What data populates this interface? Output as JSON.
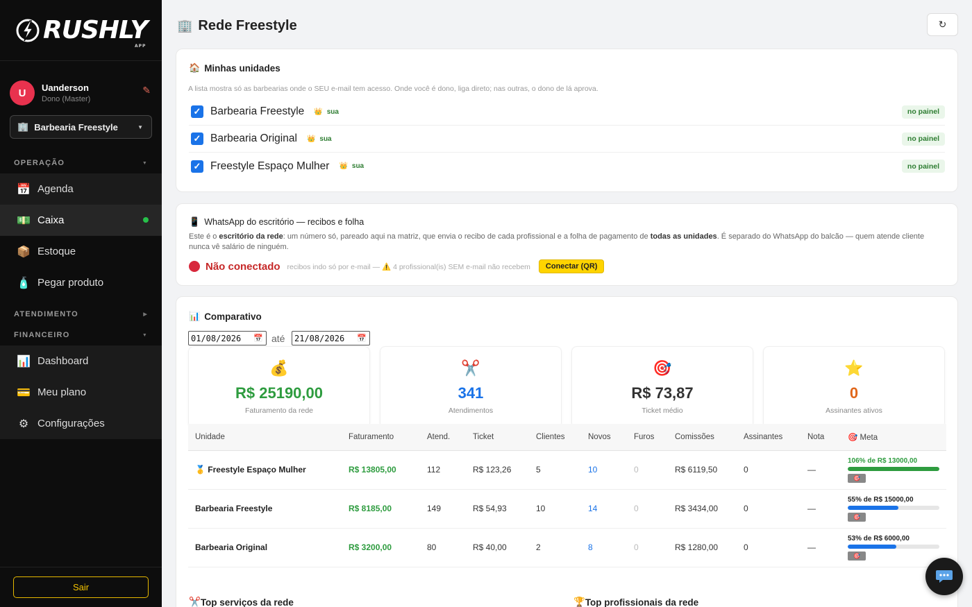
{
  "brand": {
    "name": "RUSHLY",
    "sub": "APP"
  },
  "user": {
    "initial": "U",
    "name": "Uanderson",
    "role": "Dono (Master)"
  },
  "shop_selector": {
    "value": "Barbearia Freestyle"
  },
  "sidebar": {
    "sections": {
      "operacao": "OPERAÇÃO",
      "atendimento": "ATENDIMENTO",
      "financeiro": "FINANCEIRO"
    },
    "items": {
      "agenda": "Agenda",
      "caixa": "Caixa",
      "estoque": "Estoque",
      "pegar": "Pegar produto",
      "dashboard": "Dashboard",
      "plano": "Meu plano",
      "config": "Configurações"
    },
    "logout": "Sair"
  },
  "page": {
    "title": "Rede Freestyle"
  },
  "units_card": {
    "title": "Minhas unidades",
    "hint": "A lista mostra só as barbearias onde o SEU e-mail tem acesso. Onde você é dono, liga direto; nas outras, o dono de lá aprova.",
    "units": [
      {
        "name": "Barbearia Freestyle",
        "tag": "sua",
        "badge": "no painel"
      },
      {
        "name": "Barbearia Original",
        "tag": "sua",
        "badge": "no painel"
      },
      {
        "name": "Freestyle Espaço Mulher",
        "tag": "sua",
        "badge": "no painel"
      }
    ]
  },
  "whatsapp_card": {
    "title": "WhatsApp do escritório — recibos e folha",
    "desc_pre": "Este é o ",
    "desc_b1": "escritório da rede",
    "desc_mid": ": um número só, pareado aqui na matriz, que envia o recibo de cada profissional e a folha de pagamento de ",
    "desc_b2": "todas as unidades",
    "desc_post": ". É separado do WhatsApp do balcão — quem atende cliente nunca vê salário de ninguém.",
    "status": "Não conectado",
    "status_hint": "recibos indo só por e-mail — ⚠️ 4 profissional(is) SEM e-mail não recebem",
    "connect": "Conectar (QR)",
    "status_color": "#c62828"
  },
  "compare_card": {
    "title": "Comparativo",
    "date_from": "01/08/2026",
    "date_sep": "até",
    "date_to": "21/08/2026",
    "kpis": [
      {
        "icon": "💰",
        "value": "R$ 25190,00",
        "label": "Faturamento da rede",
        "color": "#2e9c3f"
      },
      {
        "icon": "✂️",
        "value": "341",
        "label": "Atendimentos",
        "color": "#1a73e8"
      },
      {
        "icon": "🎯",
        "value": "R$ 73,87",
        "label": "Ticket médio",
        "color": "#333333"
      },
      {
        "icon": "⭐",
        "value": "0",
        "label": "Assinantes ativos",
        "color": "#e0661a"
      }
    ],
    "columns": [
      "Unidade",
      "Faturamento",
      "Atend.",
      "Ticket",
      "Clientes",
      "Novos",
      "Furos",
      "Comissões",
      "Assinantes",
      "Nota",
      "Meta"
    ],
    "rows": [
      {
        "medal": "🥇",
        "unit": "Freestyle Espaço Mulher",
        "fat": "R$ 13805,00",
        "atend": "112",
        "ticket": "R$ 123,26",
        "clientes": "5",
        "novos": "10",
        "furos": "0",
        "comissoes": "R$ 6119,50",
        "assinantes": "0",
        "nota": "—",
        "meta_label": "106% de R$ 13000,00",
        "meta_pct": 1.0,
        "meta_color": "#2e9c3f"
      },
      {
        "medal": "",
        "unit": "Barbearia Freestyle",
        "fat": "R$ 8185,00",
        "atend": "149",
        "ticket": "R$ 54,93",
        "clientes": "10",
        "novos": "14",
        "furos": "0",
        "comissoes": "R$ 3434,00",
        "assinantes": "0",
        "nota": "—",
        "meta_label": "55% de R$ 15000,00",
        "meta_pct": 0.55,
        "meta_color": "#1a73e8"
      },
      {
        "medal": "",
        "unit": "Barbearia Original",
        "fat": "R$ 3200,00",
        "atend": "80",
        "ticket": "R$ 40,00",
        "clientes": "2",
        "novos": "8",
        "furos": "0",
        "comissoes": "R$ 1280,00",
        "assinantes": "0",
        "nota": "—",
        "meta_label": "53% de R$ 6000,00",
        "meta_pct": 0.53,
        "meta_color": "#1a73e8"
      }
    ]
  },
  "bottom": {
    "top_services": "Top serviços da rede",
    "top_pros": "Top profissionais da rede"
  }
}
